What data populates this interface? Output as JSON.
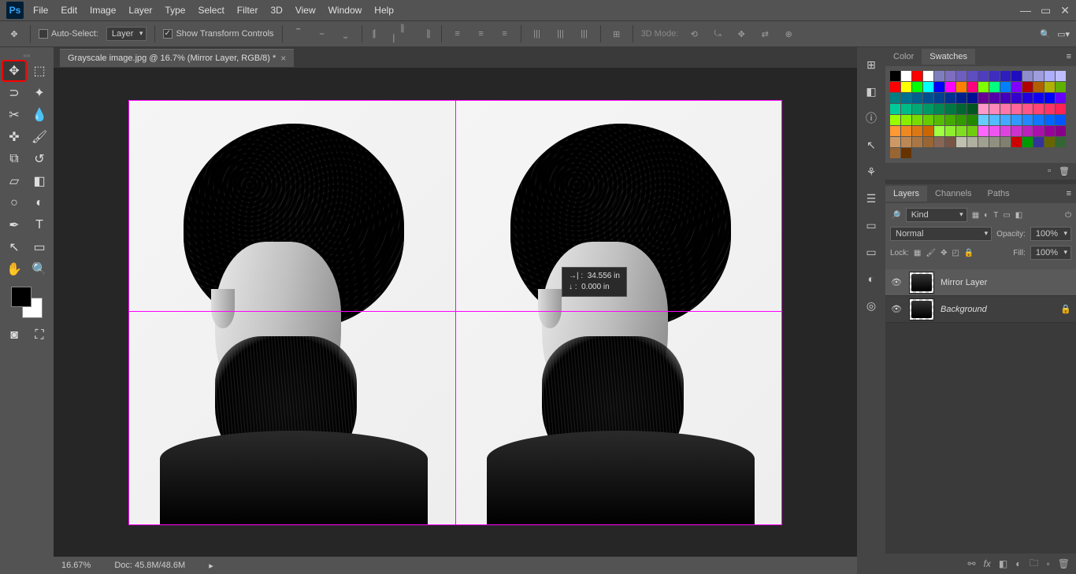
{
  "menubar": [
    "File",
    "Edit",
    "Image",
    "Layer",
    "Type",
    "Select",
    "Filter",
    "3D",
    "View",
    "Window",
    "Help"
  ],
  "options": {
    "auto_select": "Auto-Select:",
    "auto_select_target": "Layer",
    "show_transform": "Show Transform Controls",
    "mode3d_label": "3D Mode:"
  },
  "document": {
    "tab_title": "Grayscale image.jpg @ 16.7% (Mirror Layer, RGB/8) *",
    "zoom": "16.67%",
    "doc_size": "Doc: 45.8M/48.6M"
  },
  "measurement": {
    "dx_label": "→|",
    "dx_value": "34.556 in",
    "dy_label": "↓",
    "dy_value": "0.000 in"
  },
  "panel_icons": [
    "⊞",
    "◧",
    "ⓘ",
    "↖",
    "⚘",
    "☰",
    "▭",
    "▭",
    "◐",
    "◎"
  ],
  "panels": {
    "group1": {
      "tabs": [
        "Color",
        "Swatches"
      ],
      "active": 1
    },
    "group2": {
      "tabs": [
        "Layers",
        "Channels",
        "Paths"
      ],
      "active": 0
    }
  },
  "swatches": [
    "#000000",
    "#ffffff",
    "#ff0000",
    "#ffffff",
    "#7e7ebf",
    "#7e6ebf",
    "#6e5ebf",
    "#5e4ebf",
    "#4e3ebf",
    "#3e2ebf",
    "#2e1ebf",
    "#1e0ebf",
    "#8e8ecf",
    "#9e9edf",
    "#aeaeff",
    "#bebeff",
    "#ff0000",
    "#ffff00",
    "#00ff00",
    "#00ffff",
    "#0000ff",
    "#ff00ff",
    "#ff7f00",
    "#ff007f",
    "#7fff00",
    "#00ff7f",
    "#007fff",
    "#7f00ff",
    "#b00000",
    "#b06000",
    "#b0b000",
    "#60b000",
    "#008080",
    "#007090",
    "#006090",
    "#005090",
    "#004090",
    "#003090",
    "#002090",
    "#001090",
    "#660099",
    "#5500aa",
    "#4400bb",
    "#3300cc",
    "#2200dd",
    "#1100ee",
    "#0000ff",
    "#6600ff",
    "#00cc99",
    "#00bb88",
    "#00aa77",
    "#009966",
    "#008855",
    "#007744",
    "#006633",
    "#005522",
    "#ff99cc",
    "#ff88bb",
    "#ff77aa",
    "#ff6699",
    "#ff5588",
    "#ff4477",
    "#ff3366",
    "#ff2255",
    "#99ff00",
    "#88ee00",
    "#77dd00",
    "#66cc00",
    "#55bb00",
    "#44aa00",
    "#339900",
    "#228800",
    "#66ccff",
    "#55bbff",
    "#44aaff",
    "#3399ff",
    "#2288ff",
    "#1177ff",
    "#0066ff",
    "#0055ff",
    "#ff9933",
    "#ee8822",
    "#dd7711",
    "#cc6600",
    "#a0ff40",
    "#90ee30",
    "#80dd20",
    "#70cc10",
    "#ff66ff",
    "#ee55ee",
    "#dd44dd",
    "#cc33cc",
    "#bb22bb",
    "#aa11aa",
    "#990099",
    "#880088",
    "#cc9966",
    "#bb8855",
    "#aa7744",
    "#996633",
    "#886655",
    "#775544",
    "#c0c0b0",
    "#b0b0a0",
    "#a0a090",
    "#909080",
    "#808070",
    "#cc0000",
    "#009900",
    "#333399",
    "#666600",
    "#336633",
    "#996633",
    "#663300"
  ],
  "layers": {
    "filter_label": "Kind",
    "blend_mode": "Normal",
    "opacity_label": "Opacity:",
    "opacity_value": "100%",
    "lock_label": "Lock:",
    "fill_label": "Fill:",
    "fill_value": "100%",
    "items": [
      {
        "name": "Mirror Layer",
        "active": true,
        "locked": false
      },
      {
        "name": "Background",
        "active": false,
        "locked": true
      }
    ]
  },
  "tools": [
    [
      "move",
      "marquee"
    ],
    [
      "lasso",
      "magic-wand"
    ],
    [
      "crop",
      "eyedropper"
    ],
    [
      "spot-heal",
      "brush"
    ],
    [
      "clone",
      "history-brush"
    ],
    [
      "eraser",
      "gradient"
    ],
    [
      "blur",
      "dodge"
    ],
    [
      "pen",
      "type"
    ],
    [
      "path-select",
      "shape"
    ],
    [
      "hand",
      "zoom"
    ]
  ],
  "tool_glyphs": {
    "move": "✥",
    "marquee": "⬚",
    "lasso": "⊃",
    "magic-wand": "✦",
    "crop": "✂",
    "eyedropper": "💧",
    "spot-heal": "✜",
    "brush": "🖌",
    "clone": "⧉",
    "history-brush": "↺",
    "eraser": "▱",
    "gradient": "◧",
    "blur": "○",
    "dodge": "◐",
    "pen": "✒",
    "type": "T",
    "path-select": "↖",
    "shape": "▭",
    "hand": "✋",
    "zoom": "🔍"
  }
}
